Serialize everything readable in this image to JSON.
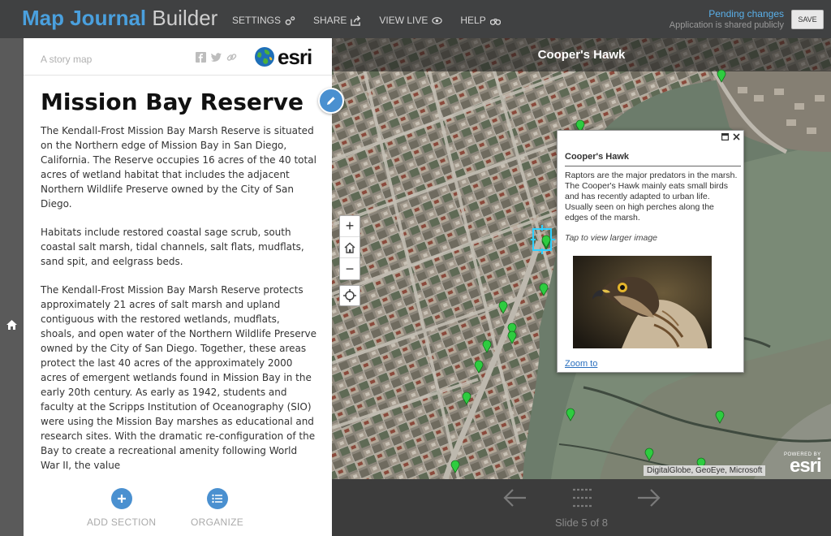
{
  "app": {
    "brand_part1": "Map Journal",
    "brand_part2": "Builder",
    "nav": [
      {
        "label": "SETTINGS",
        "icon": "gears-icon"
      },
      {
        "label": "SHARE",
        "icon": "share-icon"
      },
      {
        "label": "VIEW LIVE",
        "icon": "eye-icon"
      },
      {
        "label": "HELP",
        "icon": "binoculars-icon"
      }
    ],
    "pending": "Pending changes",
    "shared": "Application is shared publicly",
    "save_label": "SAVE"
  },
  "panel": {
    "storymap_label": "A story map",
    "esri_word": "esri",
    "title": "Mission Bay Reserve",
    "paragraphs": [
      "The Kendall-Frost Mission Bay Marsh Reserve is situated on the Northern edge of Mission Bay in San Diego, California. The Reserve occupies 16 acres of the 40 total acres of wetland habitat that includes the adjacent Northern Wildlife Preserve owned by the City of San Diego.",
      "Habitats include restored coastal sage scrub, south coastal salt marsh, tidal channels, salt flats, mudflats, sand spit, and eelgrass beds.",
      "The Kendall-Frost Mission Bay Marsh Reserve protects approximately 21 acres of salt marsh and upland contiguous with the restored wetlands, mudflats, shoals, and open water of the Northern Wildlife Preserve owned by the City of San Diego.  Together, these areas protect the last 40 acres of the approximately 2000 acres of emergent wetlands found in Mission Bay in the early 20th century. As early as 1942, students and faculty at the Scripps Institution of Oceanography (SIO) were using the Mission Bay marshes as educational and research sites.  With the dramatic re-configuration of the Bay to create a recreational amenity following World War II, the value"
    ],
    "add_section": "ADD SECTION",
    "organize": "ORGANIZE"
  },
  "map": {
    "title": "Cooper's Hawk",
    "attribution": "DigitalGlobe, GeoEye, Microsoft",
    "powered_by": "POWERED BY",
    "powered_word": "esri",
    "zoom_in": "+",
    "zoom_out": "−",
    "popup": {
      "title": "Cooper's Hawk",
      "body": "Raptors are the major predators in the marsh. The Cooper's Hawk mainly eats small birds and has recently adapted to urban life. Usually seen on high perches along the edges of the marsh.",
      "tap": "Tap to view larger image",
      "zoom_link": "Zoom to"
    }
  },
  "bottom": {
    "slide_label": "Slide 5 of 8"
  }
}
